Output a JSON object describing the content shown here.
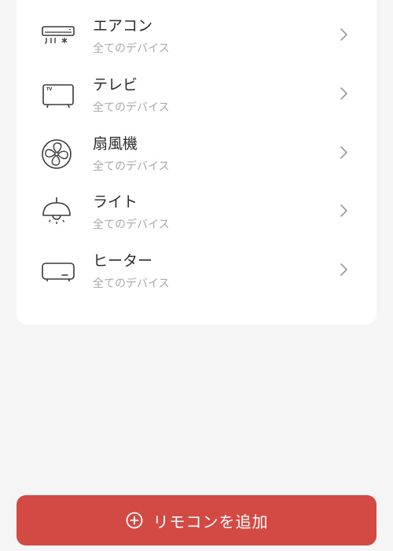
{
  "device_list": {
    "items": [
      {
        "id": "aircon",
        "name": "エアコン",
        "subtitle": "全てのデバイス",
        "icon": "air-conditioner-icon"
      },
      {
        "id": "tv",
        "name": "テレビ",
        "subtitle": "全てのデバイス",
        "icon": "tv-icon"
      },
      {
        "id": "fan",
        "name": "扇風機",
        "subtitle": "全てのデバイス",
        "icon": "fan-icon"
      },
      {
        "id": "light",
        "name": "ライト",
        "subtitle": "全てのデバイス",
        "icon": "ceiling-light-icon"
      },
      {
        "id": "heater",
        "name": "ヒーター",
        "subtitle": "全てのデバイス",
        "icon": "heater-icon"
      }
    ]
  },
  "add_remote": {
    "label": "リモコンを追加",
    "icon": "add-circle-icon"
  },
  "colors": {
    "background": "#f5f5f5",
    "card": "#ffffff",
    "accent": "#d34a44",
    "title_text": "#2b2b2b",
    "subtitle_text": "#a9a9a9",
    "icon_stroke": "#3a3a3a",
    "chevron": "#9a9a9a"
  }
}
